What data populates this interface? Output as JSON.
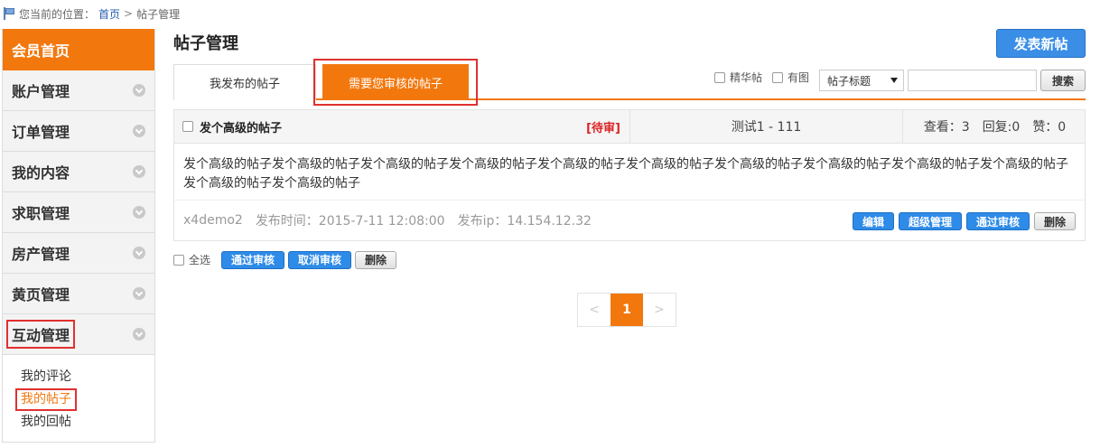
{
  "breadcrumb": {
    "prefix": "您当前的位置：",
    "home": "首页",
    "separator": ">",
    "current": "帖子管理"
  },
  "sidebar": {
    "home": "会员首页",
    "items": [
      {
        "label": "账户管理"
      },
      {
        "label": "订单管理"
      },
      {
        "label": "我的内容"
      },
      {
        "label": "求职管理"
      },
      {
        "label": "房产管理"
      },
      {
        "label": "黄页管理"
      },
      {
        "label": "互动管理"
      }
    ],
    "sub_items": [
      {
        "label": "我的评论"
      },
      {
        "label": "我的帖子"
      },
      {
        "label": "我的回帖"
      }
    ]
  },
  "header": {
    "title": "帖子管理",
    "post_button": "发表新帖"
  },
  "tabs": [
    {
      "label": "我发布的帖子"
    },
    {
      "label": "需要您审核的帖子"
    }
  ],
  "filters": {
    "featured": "精华帖",
    "has_image": "有图",
    "field_select": "帖子标题",
    "search_value": "",
    "search_button": "搜索"
  },
  "post": {
    "title": "发个高级的帖子",
    "status": "[待审]",
    "category": "测试1 - 111",
    "views": "查看：3",
    "replies": "回复:0",
    "likes": "赞：0",
    "body": "发个高级的帖子发个高级的帖子发个高级的帖子发个高级的帖子发个高级的帖子发个高级的帖子发个高级的帖子发个高级的帖子发个高级的帖子发个高级的帖子发个高级的帖子发个高级的帖子",
    "author": "x4demo2",
    "time": "发布时间：2015-7-11 12:08:00",
    "ip": "发布ip：14.154.12.32",
    "actions": {
      "edit": "编辑",
      "super": "超级管理",
      "approve": "通过审核",
      "delete": "删除"
    }
  },
  "bulk": {
    "select_all": "全选",
    "approve": "通过审核",
    "cancel": "取消审核",
    "delete": "删除"
  },
  "pagination": {
    "prev": "<",
    "current": "1",
    "next": ">"
  }
}
